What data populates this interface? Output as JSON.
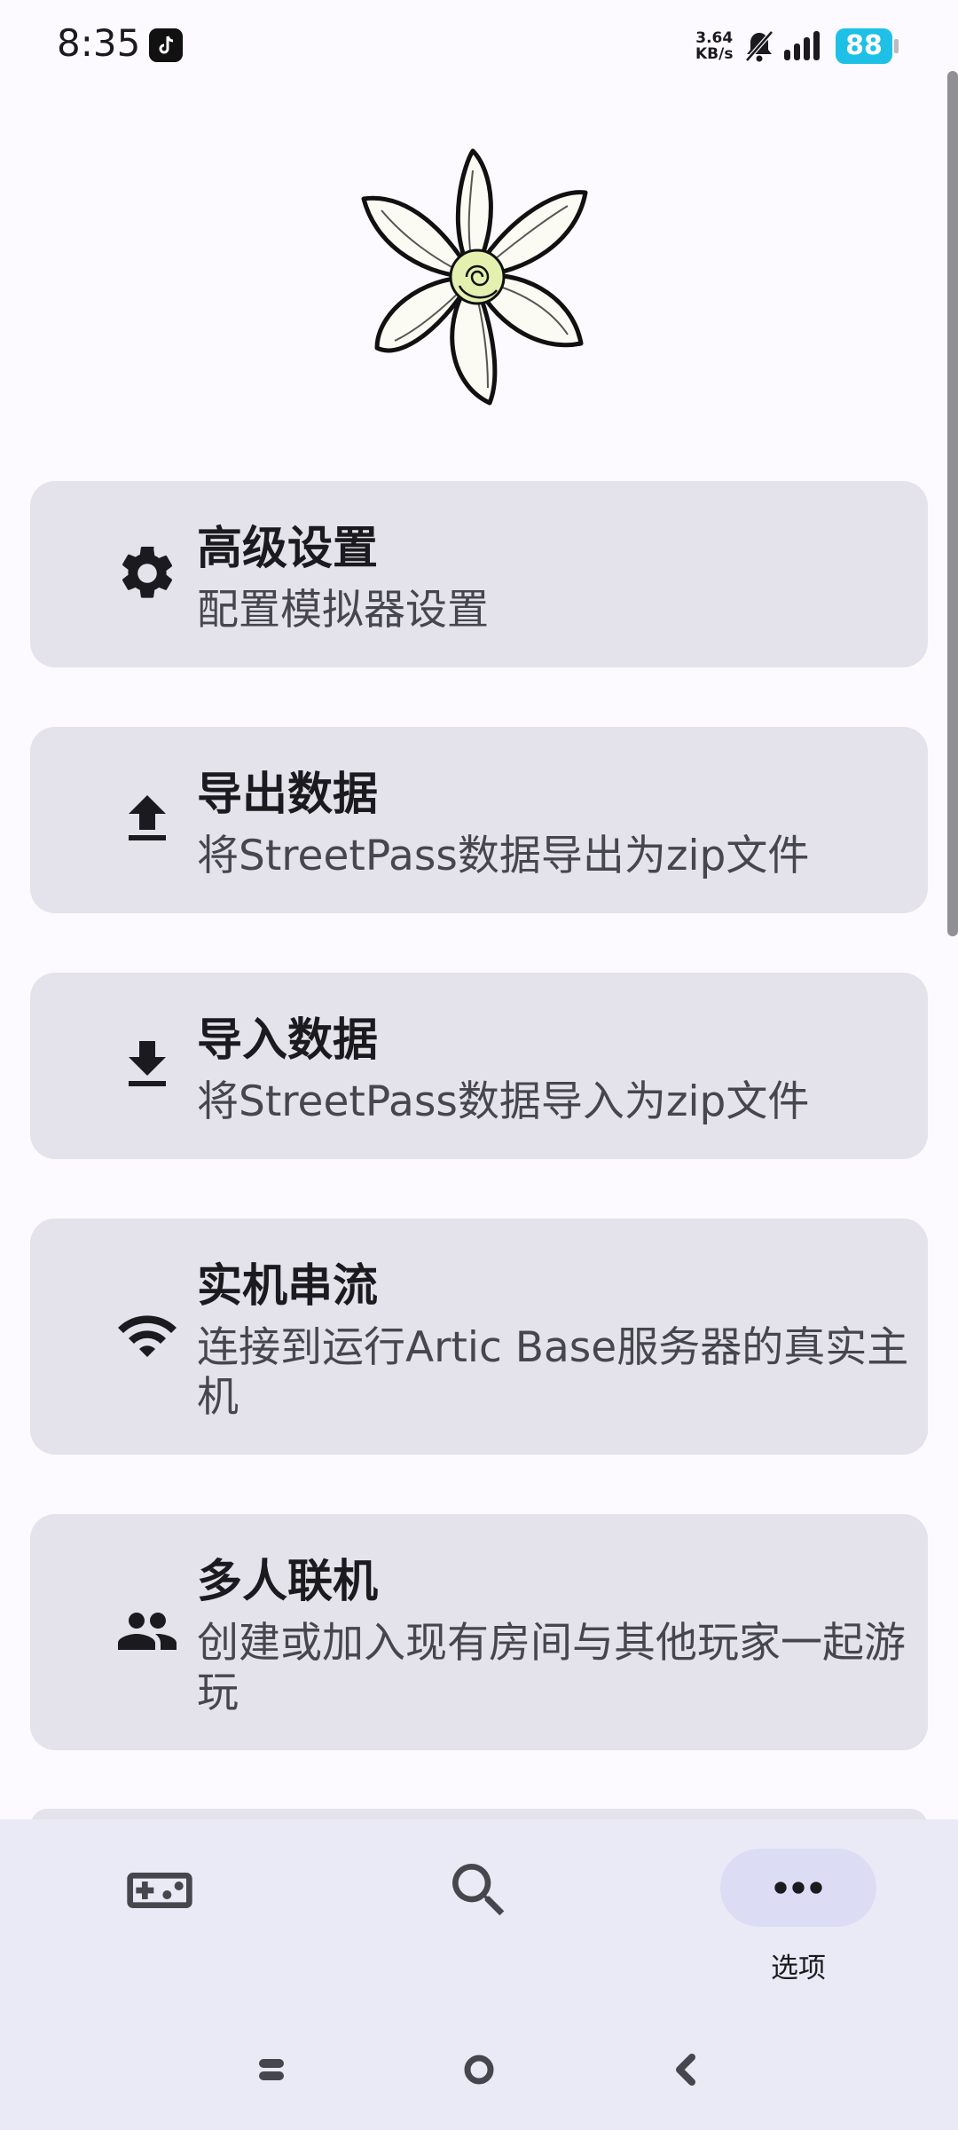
{
  "status_bar": {
    "time": "8:35",
    "net_speed_value": "3.64",
    "net_speed_unit": "KB/s",
    "battery": "88"
  },
  "settings": {
    "items": [
      {
        "title": "高级设置",
        "description": "配置模拟器设置",
        "icon": "gear-icon"
      },
      {
        "title": "导出数据",
        "description": "将StreetPass数据导出为zip文件",
        "icon": "upload-icon"
      },
      {
        "title": "导入数据",
        "description": "将StreetPass数据导入为zip文件",
        "icon": "download-icon"
      },
      {
        "title": "实机串流",
        "description": "连接到运行Artic Base服务器的真实主机",
        "icon": "wifi-icon"
      },
      {
        "title": "多人联机",
        "description": "创建或加入现有房间与其他玩家一起游玩",
        "icon": "people-icon"
      }
    ]
  },
  "bottom_nav": {
    "items": [
      {
        "icon": "gamepad-icon",
        "label": ""
      },
      {
        "icon": "search-icon",
        "label": ""
      },
      {
        "icon": "more-icon",
        "label": "选项",
        "selected": true
      }
    ]
  },
  "colors": {
    "background": "#fcfaff",
    "card": "#e4e2ea",
    "nav_background": "#eaeaf6",
    "nav_selected_pill": "#dcdcf4",
    "battery": "#1ec0e6"
  }
}
